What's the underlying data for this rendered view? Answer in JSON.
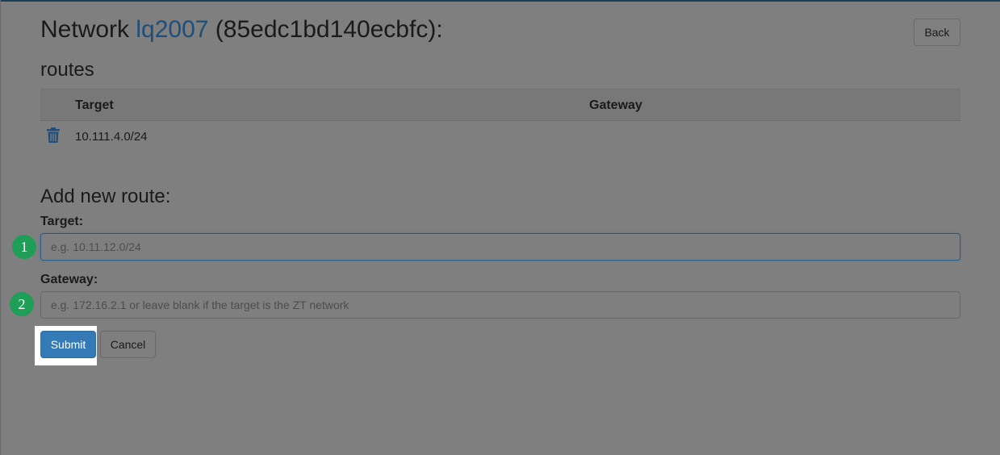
{
  "header": {
    "title_prefix": "Network ",
    "network_name": "lq2007",
    "network_id_suffix": " (85edc1bd140ecbfc):",
    "back_label": "Back"
  },
  "routes": {
    "section_title": "routes",
    "columns": [
      "Target",
      "Gateway"
    ],
    "rows": [
      {
        "target": "10.111.4.0/24",
        "gateway": ""
      }
    ]
  },
  "add_route": {
    "title": "Add new route:",
    "target_label": "Target:",
    "target_placeholder": "e.g. 10.11.12.0/24",
    "target_value": "",
    "gateway_label": "Gateway:",
    "gateway_placeholder": "e.g. 172.16.2.1 or leave blank if the target is the ZT network",
    "gateway_value": "",
    "submit_label": "Submit",
    "cancel_label": "Cancel"
  },
  "annotations": {
    "badge_1": "1",
    "badge_2": "2"
  },
  "colors": {
    "overlay_background": "#7f7f7f",
    "link": "#1f4e78",
    "primary_button": "#337ab7",
    "badge": "#1e9e56",
    "highlight": "#ffffff"
  },
  "icons": {
    "delete_route": "trash-icon"
  }
}
